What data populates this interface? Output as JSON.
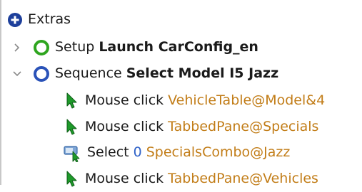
{
  "tree": {
    "extras": {
      "icon": "plus-circle-icon",
      "label": "Extras"
    },
    "setup": {
      "expander": "chevron-right-icon",
      "icon": "setup-ring-icon",
      "icon_color": "#2ea51f",
      "type_label": "Setup",
      "name": "Launch CarConfig_en"
    },
    "sequence": {
      "expander": "chevron-down-icon",
      "icon": "sequence-ring-icon",
      "icon_color": "#2a52b8",
      "type_label": "Sequence",
      "name": "Select Model I5 Jazz"
    },
    "steps": [
      {
        "icon": "mouse-cursor-icon",
        "action": "Mouse click",
        "target": "VehicleTable@Model&4"
      },
      {
        "icon": "mouse-cursor-icon",
        "action": "Mouse click",
        "target": "TabbedPane@Specials"
      },
      {
        "icon": "select-combobox-icon",
        "action": "Select",
        "index": "0",
        "target": "SpecialsCombo@Jazz"
      },
      {
        "icon": "mouse-cursor-icon",
        "action": "Mouse click",
        "target": "TabbedPane@Vehicles"
      }
    ]
  }
}
